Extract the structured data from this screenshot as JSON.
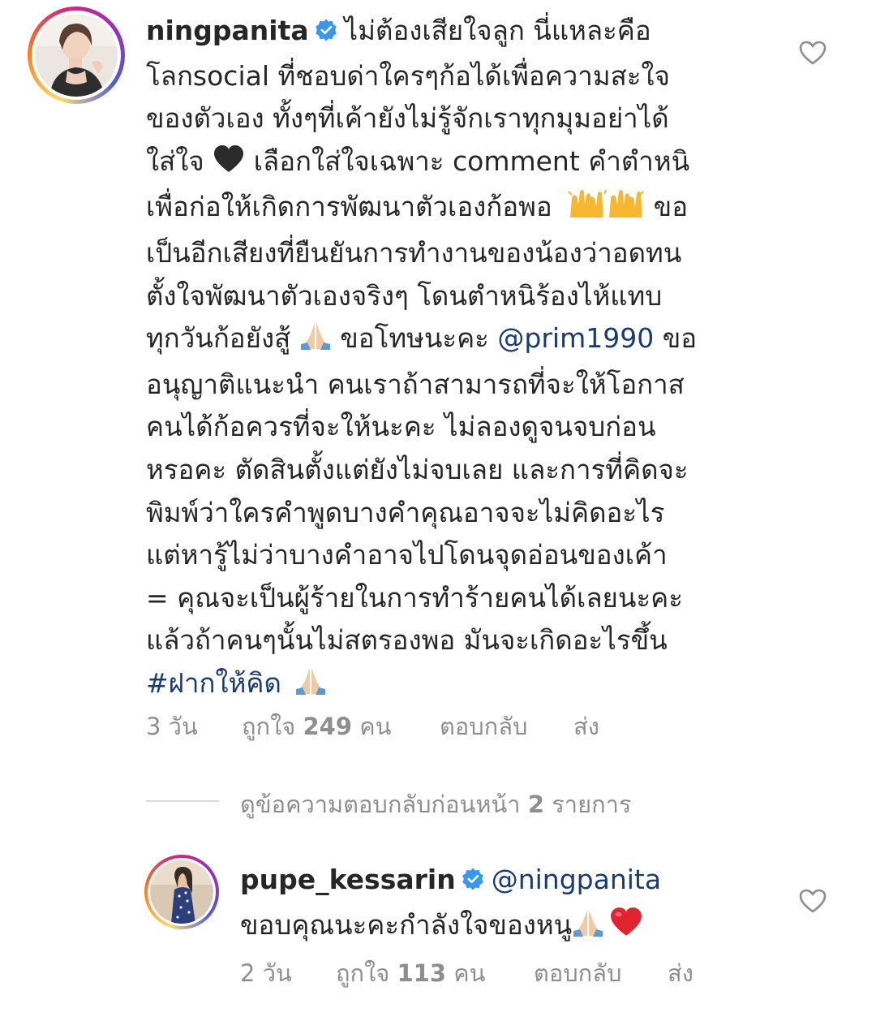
{
  "comment": {
    "username": "ningpanita",
    "lines": [
      "ไม่ต้องเสียใจลูก นี่แหละคือ",
      "โลกsocial ที่ชอบด่าใครๆก้อได้เพื่อความสะใจ",
      "ของตัวเอง ทั้งๆที่เค้ายังไม่รู้จักเราทุกมุมอย่าได้",
      "ใส่ใจ",
      "เลือกใส่ใจเฉพาะ comment คำตำหนิ",
      "เพื่อก่อให้เกิดการพัฒนาตัวเองก้อพอ",
      "ขอ",
      "เป็นอีกเสียงที่ยืนยันการทำงานของน้องว่าอดทน",
      "ตั้งใจพัฒนาตัวเองจริงๆ โดนตำหนิร้องไห้แทบ",
      "ทุกวันก้อยังสู้",
      "ขอโทษนะคะ",
      "@prim1990",
      "ขอ",
      "อนุญาติแนะนำ คนเราถ้าสามารถที่จะให้โอกาส",
      "คนได้ก้อควรที่จะให้นะคะ ไม่ลองดูจนจบก่อน",
      "หรอคะ ตัดสินตั้งแต่ยังไม่จบเลย และการที่คิดจะ",
      "พิมพ์ว่าใครคำพูดบางคำคุณอาจจะไม่คิดอะไร",
      "แต่หารู้ไม่ว่าบางคำอาจไปโดนจุดอ่อนของเค้า",
      "= คุณจะเป็นผู้ร้ายในการทำร้ายคนได้เลยนะคะ",
      "แล้วถ้าคนๆนั้นไม่สตรองพอ มันจะเกิดอะไรขึ้น",
      "#ฝากให้คิด"
    ],
    "time": "3 วัน",
    "likes_prefix": "ถูกใจ",
    "likes_count": "249",
    "likes_suffix": "คน",
    "reply_label": "ตอบกลับ",
    "send_label": "ส่ง"
  },
  "view_replies": {
    "prefix": "ดูข้อความตอบกลับก่อนหน้า",
    "count": "2",
    "suffix": "รายการ"
  },
  "reply": {
    "username": "pupe_kessarin",
    "mention": "@ningpanita",
    "text": "ขอบคุณนะคะกำลังใจของหนู",
    "time": "2 วัน",
    "likes_prefix": "ถูกใจ",
    "likes_count": "113",
    "likes_suffix": "คน",
    "reply_label": "ตอบกลับ",
    "send_label": "ส่ง"
  },
  "colors": {
    "text": "#262626",
    "meta": "#8e8e8e",
    "link": "#1a3b6e",
    "verified": "#3897f0",
    "heart_outline": "#8e8e8e"
  },
  "icons": [
    "verified-badge-icon",
    "heart-outline-icon",
    "black-heart-emoji",
    "raising-hands-emoji",
    "folded-hands-emoji",
    "red-heart-emoji"
  ]
}
